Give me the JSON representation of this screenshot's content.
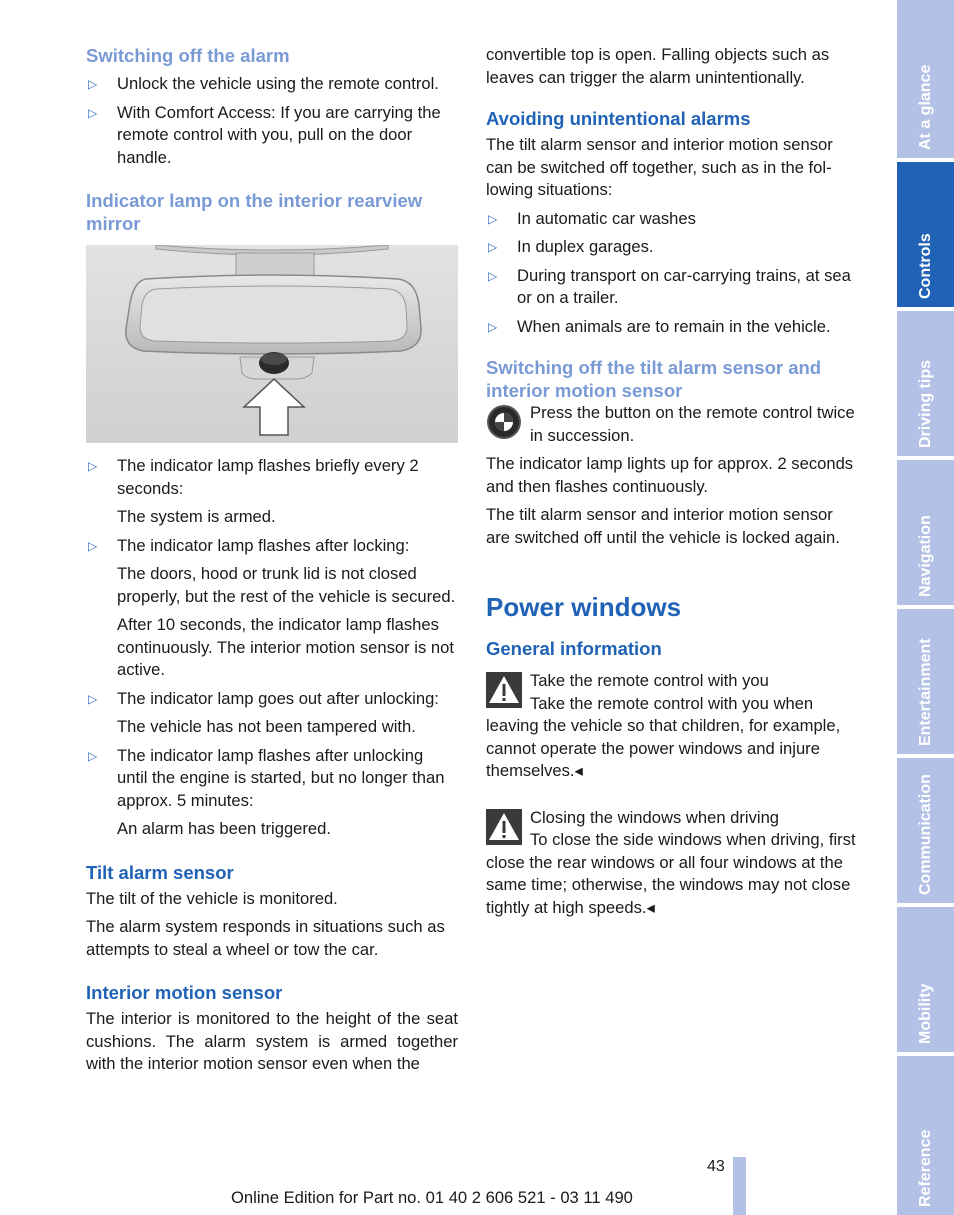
{
  "left": {
    "h_switch_off": "Switching off the alarm",
    "switch_off_items": [
      "Unlock the vehicle using the remote control.",
      "With Comfort Access: If you are carrying the remote control with you, pull on the door handle."
    ],
    "h_indicator": "Indicator lamp on the interior rearview mirror",
    "indicator_items": [
      {
        "text": "The indicator lamp flashes briefly every 2 seconds:",
        "sub": [
          "The system is armed."
        ]
      },
      {
        "text": "The indicator lamp flashes after locking:",
        "sub": [
          "The doors, hood or trunk lid is not closed properly, but the rest of the vehicle is se­cured.",
          "After 10 seconds, the indicator lamp flashes continuously. The interior motion sensor is not active."
        ]
      },
      {
        "text": "The indicator lamp goes out after unlocking:",
        "sub": [
          "The vehicle has not been tampered with."
        ]
      },
      {
        "text": "The indicator lamp flashes after unlocking until the engine is started, but no longer than approx. 5 minutes:",
        "sub": [
          "An alarm has been triggered."
        ]
      }
    ],
    "h_tilt": "Tilt alarm sensor",
    "tilt_p1": "The tilt of the vehicle is monitored.",
    "tilt_p2": "The alarm system responds in situations such as attempts to steal a wheel or tow the car.",
    "h_interior": "Interior motion sensor",
    "interior_p": "The interior is monitored to the height of the seat cushions. The alarm system is armed together with the interior motion sensor even when the"
  },
  "right": {
    "cont_p": "convertible top is open. Falling objects such as leaves can trigger the alarm unintentionally.",
    "h_avoid": "Avoiding unintentional alarms",
    "avoid_p": "The tilt alarm sensor and interior motion sensor can be switched off together, such as in the fol­lowing situations:",
    "avoid_items": [
      "In automatic car washes",
      "In duplex garages.",
      "During transport on car-carrying trains, at sea or on a trailer.",
      "When animals are to remain in the vehicle."
    ],
    "h_switch_tilt": "Switching off the tilt alarm sensor and interior motion sensor",
    "press_text": "Press the button on the remote control twice in succession.",
    "lamp_p": "The indicator lamp lights up for approx. 2 sec­onds and then flashes continuously.",
    "off_p": "The tilt alarm sensor and interior motion sensor are switched off until the vehicle is locked again.",
    "h_power": "Power windows",
    "h_general": "General information",
    "warn1_title": "Take the remote control with you",
    "warn1_body": "Take the remote control with you when leaving the vehicle so that children, for example, cannot operate the power windows and injure themselves.◂",
    "warn2_title": "Closing the windows when driving",
    "warn2_body": "To close the side windows when driving, first close the rear windows or all four windows at the same time; otherwise, the windows may not close tightly at high speeds.◂"
  },
  "sidebar": {
    "tabs": [
      {
        "label": "At a glance",
        "active": false
      },
      {
        "label": "Controls",
        "active": true
      },
      {
        "label": "Driving tips",
        "active": false
      },
      {
        "label": "Navigation",
        "active": false
      },
      {
        "label": "Entertainment",
        "active": false
      },
      {
        "label": "Communication",
        "active": false
      },
      {
        "label": "Mobility",
        "active": false
      },
      {
        "label": "Reference",
        "active": false
      }
    ]
  },
  "bullet_glyph": "▷",
  "page_number": "43",
  "footer": "Online Edition for Part no. 01 40 2 606 521 - 03 11 490",
  "colors": {
    "heading_light": "#7a9ad6",
    "heading_dark": "#1f62b6",
    "tab_inactive": "#b3c1e6",
    "tab_active": "#1f62b6"
  }
}
